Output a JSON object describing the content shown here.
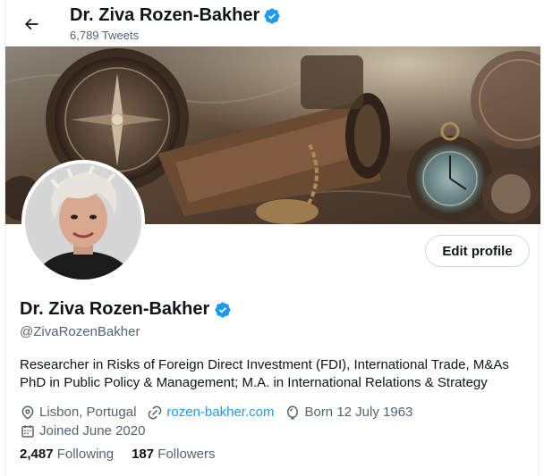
{
  "header": {
    "title": "Dr. Ziva Rozen-Bakher",
    "tweet_count": "6,789 Tweets"
  },
  "profile": {
    "name": "Dr. Ziva Rozen-Bakher",
    "handle": "@ZivaRozenBakher",
    "bio_line1": "Researcher in Risks of Foreign Direct Investment (FDI), International Trade, M&As",
    "bio_line2": "PhD in Public Policy & Management; M.A. in International Relations & Strategy",
    "location": "Lisbon, Portugal",
    "website": "rozen-bakher.com",
    "birthday": "Born 12 July 1963",
    "joined": "Joined June 2020"
  },
  "actions": {
    "edit_profile": "Edit profile"
  },
  "stats": {
    "following_count": "2,487",
    "following_label": "Following",
    "followers_count": "187",
    "followers_label": "Followers"
  },
  "colors": {
    "accent": "#1d9bf0",
    "text": "#0f1419",
    "muted": "#536471"
  }
}
